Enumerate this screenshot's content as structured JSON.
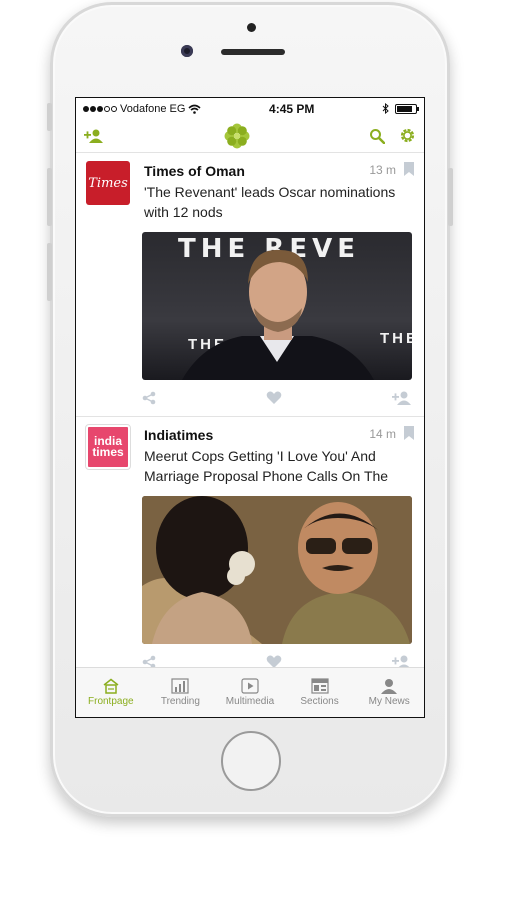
{
  "status": {
    "carrier": "Vodafone EG",
    "time": "4:45 PM"
  },
  "colors": {
    "accent": "#8bae1f",
    "muted": "#c5ccd4"
  },
  "navbar": {
    "left_icon": "add-user-icon",
    "center_icon": "flower-logo-icon",
    "right_icons": [
      "search-icon",
      "gear-icon"
    ]
  },
  "feed": [
    {
      "source": "Times of Oman",
      "logo_text": "Times",
      "time": "13 m",
      "headline": "'The Revenant' leads Oscar nominations with 12 nods",
      "image_text_top": "THE REVE",
      "image_text_bottom_left": "THE",
      "image_text_bottom_right": "THE"
    },
    {
      "source": "Indiatimes",
      "logo_line1": "india",
      "logo_line2": "times",
      "time": "14 m",
      "headline": "Meerut Cops Getting 'I Love You' And Marriage Proposal Phone Calls On The"
    }
  ],
  "tabs": [
    {
      "label": "Frontpage",
      "icon": "home-icon",
      "active": true
    },
    {
      "label": "Trending",
      "icon": "chart-icon",
      "active": false
    },
    {
      "label": "Multimedia",
      "icon": "play-icon",
      "active": false
    },
    {
      "label": "Sections",
      "icon": "sections-icon",
      "active": false
    },
    {
      "label": "My News",
      "icon": "person-icon",
      "active": false
    }
  ]
}
